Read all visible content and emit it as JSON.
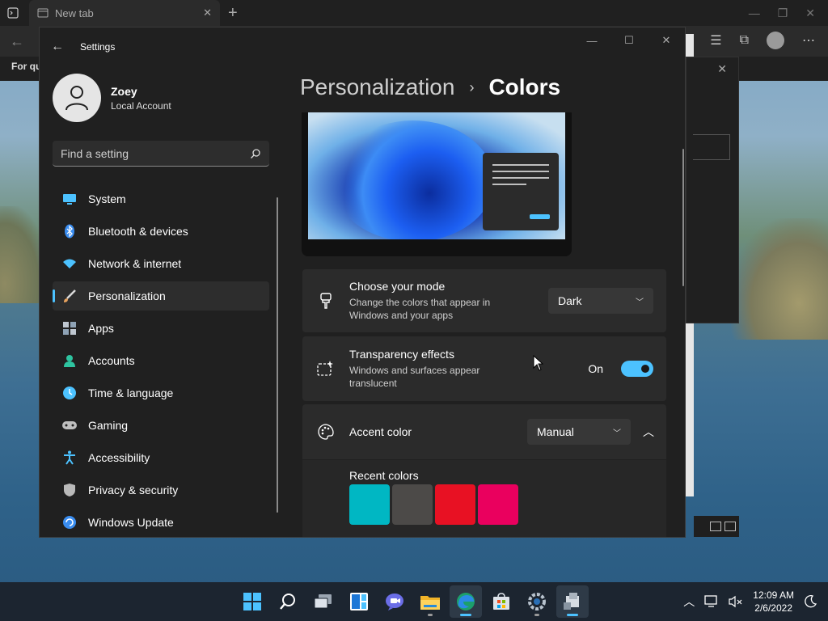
{
  "browser": {
    "tab_title": "New tab",
    "favorites_label": "For qu"
  },
  "settings": {
    "app_title": "Settings",
    "user": {
      "name": "Zoey",
      "account_type": "Local Account"
    },
    "search": {
      "placeholder": "Find a setting"
    },
    "nav": [
      {
        "label": "System",
        "icon": "monitor-icon",
        "color": "#4cc2ff"
      },
      {
        "label": "Bluetooth & devices",
        "icon": "bluetooth-icon",
        "color": "#3a8df0"
      },
      {
        "label": "Network & internet",
        "icon": "wifi-icon",
        "color": "#4cc2ff"
      },
      {
        "label": "Personalization",
        "icon": "paintbrush-icon",
        "color": "#e8a35f",
        "active": true
      },
      {
        "label": "Apps",
        "icon": "apps-icon",
        "color": "#bfc7d0"
      },
      {
        "label": "Accounts",
        "icon": "person-icon",
        "color": "#2ec4a0"
      },
      {
        "label": "Time & language",
        "icon": "globe-clock-icon",
        "color": "#4cc2ff"
      },
      {
        "label": "Gaming",
        "icon": "gamepad-icon",
        "color": "#bfbfbf"
      },
      {
        "label": "Accessibility",
        "icon": "accessibility-icon",
        "color": "#4cc2ff"
      },
      {
        "label": "Privacy & security",
        "icon": "shield-icon",
        "color": "#b9b9b9"
      },
      {
        "label": "Windows Update",
        "icon": "update-icon",
        "color": "#3a8df0"
      }
    ],
    "breadcrumb": {
      "parent": "Personalization",
      "separator": "›",
      "current": "Colors"
    },
    "mode_card": {
      "title": "Choose your mode",
      "desc": "Change the colors that appear in Windows and your apps",
      "value": "Dark"
    },
    "transparency_card": {
      "title": "Transparency effects",
      "desc": "Windows and surfaces appear translucent",
      "state_label": "On",
      "enabled": true
    },
    "accent_card": {
      "title": "Accent color",
      "value": "Manual"
    },
    "recent_colors": {
      "label": "Recent colors",
      "swatches": [
        "#00b7c3",
        "#4c4a48",
        "#e81123",
        "#ea005e"
      ]
    }
  },
  "taskbar": {
    "apps": [
      "start-icon",
      "search-icon",
      "task-view-icon",
      "widgets-icon",
      "teams-chat-icon",
      "file-explorer-icon",
      "edge-icon",
      "store-icon",
      "settings-icon",
      "app-icon"
    ],
    "clock": {
      "time": "12:09 AM",
      "date": "2/6/2022"
    }
  }
}
